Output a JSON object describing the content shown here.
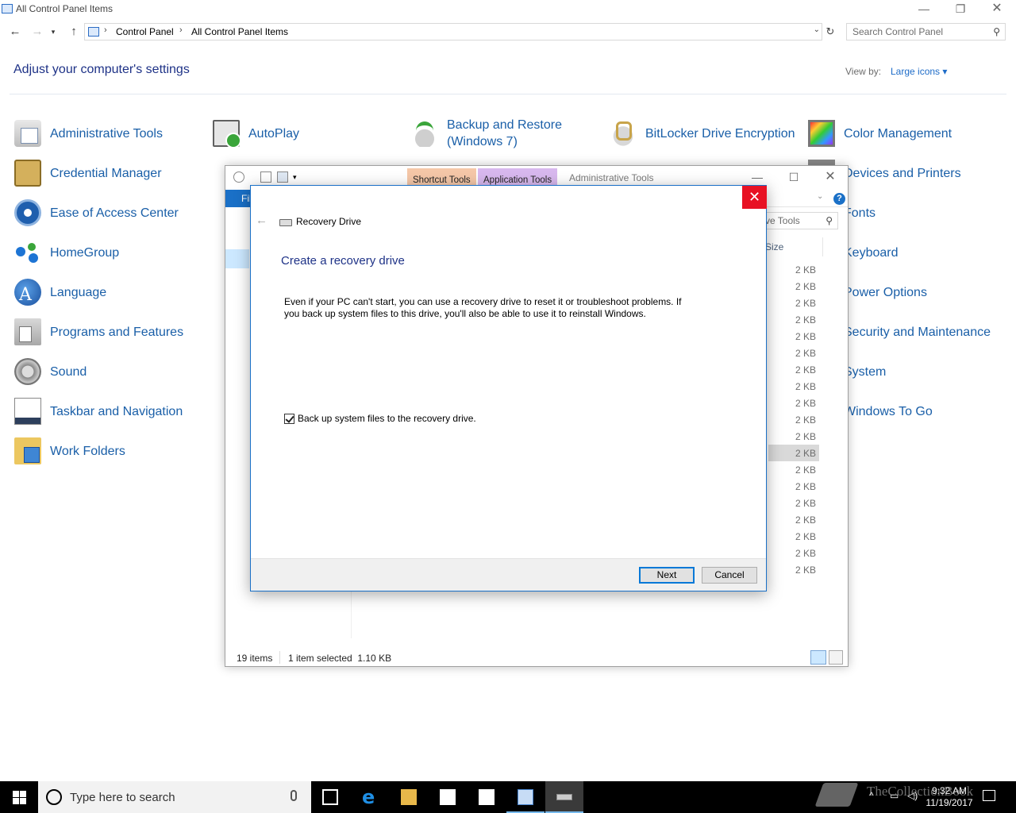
{
  "window": {
    "title": "All Control Panel Items",
    "min": "—",
    "max": "❐",
    "close": "✕"
  },
  "address": {
    "crumbs": [
      "Control Panel",
      "All Control Panel Items"
    ],
    "separator": "›",
    "search_placeholder": "Search Control Panel"
  },
  "heading": "Adjust your computer's settings",
  "view_by": {
    "label": "View by:",
    "value": "Large icons ▾"
  },
  "items": [
    {
      "label": "Administrative Tools",
      "icon": "administrative-tools-icon"
    },
    {
      "label": "AutoPlay",
      "icon": "autoplay-icon"
    },
    {
      "label": "Backup and Restore\n(Windows 7)",
      "icon": "backup-restore-icon"
    },
    {
      "label": "BitLocker Drive Encryption",
      "icon": "bitlocker-icon"
    },
    {
      "label": "Color Management",
      "icon": "color-management-icon"
    },
    {
      "label": "Credential Manager",
      "icon": "credential-manager-icon"
    },
    {
      "label": "Devices and Printers",
      "icon": "devices-printers-icon"
    },
    {
      "label": "Ease of Access Center",
      "icon": "ease-of-access-icon"
    },
    {
      "label": "Fonts",
      "icon": "fonts-icon"
    },
    {
      "label": "HomeGroup",
      "icon": "homegroup-icon"
    },
    {
      "label": "Keyboard",
      "icon": "keyboard-icon"
    },
    {
      "label": "Language",
      "icon": "language-icon"
    },
    {
      "label": "Power Options",
      "icon": "power-options-icon"
    },
    {
      "label": "Programs and Features",
      "icon": "programs-features-icon"
    },
    {
      "label": "Security and Maintenance",
      "icon": "security-maintenance-icon"
    },
    {
      "label": "Sound",
      "icon": "sound-icon"
    },
    {
      "label": "System",
      "icon": "system-icon"
    },
    {
      "label": "Taskbar and Navigation",
      "icon": "taskbar-navigation-icon"
    },
    {
      "label": "Windows To Go",
      "icon": "windows-to-go-icon"
    },
    {
      "label": "Work Folders",
      "icon": "work-folders-icon"
    }
  ],
  "explorer": {
    "tabs": [
      "Shortcut Tools",
      "Application Tools"
    ],
    "title": "Administrative Tools",
    "file_tab": "File",
    "search_text": "ve Tools",
    "size_header": "Size",
    "sizes": [
      "2 KB",
      "2 KB",
      "2 KB",
      "2 KB",
      "2 KB",
      "2 KB",
      "2 KB",
      "2 KB",
      "2 KB",
      "2 KB",
      "2 KB",
      "2 KB",
      "2 KB",
      "2 KB",
      "2 KB",
      "2 KB",
      "2 KB",
      "2 KB",
      "2 KB"
    ],
    "selected_row": 11,
    "status_items": "19 items",
    "status_selected": "1 item selected  1.10 KB",
    "help": "?"
  },
  "dialog": {
    "app_title": "Recovery Drive",
    "heading": "Create a recovery drive",
    "description": "Even if your PC can't start, you can use a recovery drive to reset it or troubleshoot problems. If you back up system files to this drive, you'll also be able to use it to reinstall Windows.",
    "checkbox_label": "Back up system files to the recovery drive.",
    "checkbox_checked": true,
    "next_label": "Next",
    "cancel_label": "Cancel",
    "close": "✕",
    "back": "←"
  },
  "taskbar": {
    "search_placeholder": "Type here to search",
    "time": "9:32 AM",
    "date": "11/19/2017",
    "watermark": "TheCollectionBook"
  }
}
